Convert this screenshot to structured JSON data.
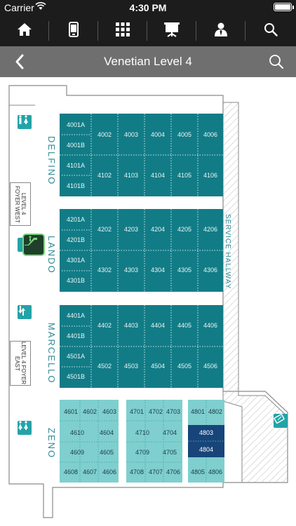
{
  "status_bar": {
    "carrier": "Carrier",
    "time": "4:30 PM"
  },
  "toolbar": {
    "items": [
      {
        "name": "home-icon"
      },
      {
        "name": "phone-icon"
      },
      {
        "name": "grid-icon"
      },
      {
        "name": "presentation-icon"
      },
      {
        "name": "profile-icon"
      },
      {
        "name": "search-icon"
      }
    ]
  },
  "header": {
    "title": "Venetian Level 4"
  },
  "map": {
    "colors": {
      "booth_dark": "#127c86",
      "booth_light": "#7fcfcf",
      "booth_selected": "#17457a",
      "wall": "#8a8a8a",
      "hatch": "#b8b8b8",
      "label_teal": "#2f8a96"
    },
    "sections": [
      {
        "name": "DELFINO"
      },
      {
        "name": "LANDO"
      },
      {
        "name": "MARCELLO"
      },
      {
        "name": "ZENO"
      }
    ],
    "service_hallway": "SERVICE HALLWAY",
    "foyer_west": "LEVEL 4 FOYER WEST",
    "foyer_east": "LEVEL 4 FOYER EAST",
    "rooms": {
      "r4001A": "4001A",
      "r4001B": "4001B",
      "r4002": "4002",
      "r4003": "4003",
      "r4004": "4004",
      "r4005": "4005",
      "r4006": "4006",
      "r4101A": "4101A",
      "r4101B": "4101B",
      "r4102": "4102",
      "r4103": "4103",
      "r4104": "4104",
      "r4105": "4105",
      "r4106": "4106",
      "r4201A": "4201A",
      "r4201B": "4201B",
      "r4202": "4202",
      "r4203": "4203",
      "r4204": "4204",
      "r4205": "4205",
      "r4206": "4206",
      "r4301A": "4301A",
      "r4301B": "4301B",
      "r4302": "4302",
      "r4303": "4303",
      "r4304": "4304",
      "r4305": "4305",
      "r4306": "4306",
      "r4401A": "4401A",
      "r4401B": "4401B",
      "r4402": "4402",
      "r4403": "4403",
      "r4404": "4404",
      "r4405": "4405",
      "r4406": "4406",
      "r4501A": "4501A",
      "r4501B": "4501B",
      "r4502": "4502",
      "r4503": "4503",
      "r4504": "4504",
      "r4505": "4505",
      "r4506": "4506",
      "r4601": "4601",
      "r4602": "4602",
      "r4603": "4603",
      "r4610": "4610",
      "r4604": "4604",
      "r4609": "4609",
      "r4605": "4605",
      "r4608": "4608",
      "r4607": "4607",
      "r4606": "4606",
      "r4701": "4701",
      "r4702": "4702",
      "r4703": "4703",
      "r4710": "4710",
      "r4704": "4704",
      "r4709": "4709",
      "r4705": "4705",
      "r4708": "4708",
      "r4707": "4707",
      "r4706": "4706",
      "r4801": "4801",
      "r4802": "4802",
      "r4803": "4803",
      "r4804": "4804",
      "r4805": "4805",
      "r4806": "4806"
    }
  }
}
